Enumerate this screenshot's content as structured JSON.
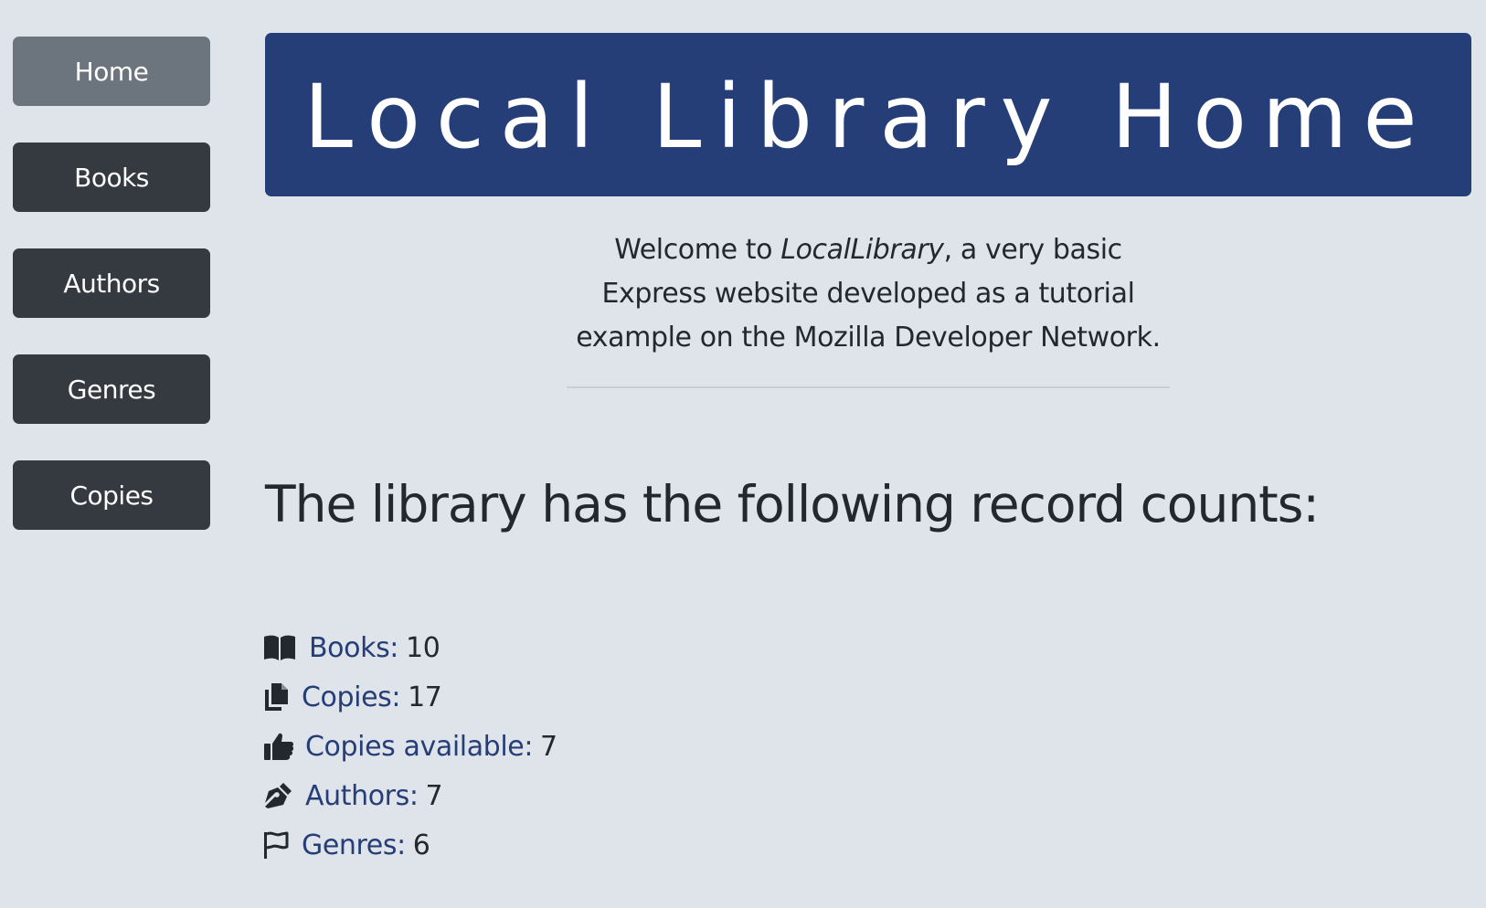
{
  "nav": {
    "items": [
      {
        "label": "Home",
        "active": true
      },
      {
        "label": "Books",
        "active": false
      },
      {
        "label": "Authors",
        "active": false
      },
      {
        "label": "Genres",
        "active": false
      },
      {
        "label": "Copies",
        "active": false
      }
    ]
  },
  "banner": {
    "title": "Local Library Home"
  },
  "intro": {
    "prefix": "Welcome to ",
    "app_name": "LocalLibrary",
    "suffix": ", a very basic Express website developed as a tutorial example on the Mozilla Developer Network."
  },
  "counts": {
    "heading": "The library has the following record counts:",
    "items": [
      {
        "icon": "book-open-icon",
        "label": "Books:",
        "value": "10"
      },
      {
        "icon": "copies-icon",
        "label": "Copies:",
        "value": "17"
      },
      {
        "icon": "thumbs-up-icon",
        "label": "Copies available:",
        "value": "7"
      },
      {
        "icon": "pen-nib-icon",
        "label": "Authors:",
        "value": "7"
      },
      {
        "icon": "flag-icon",
        "label": "Genres:",
        "value": "6"
      }
    ]
  },
  "colors": {
    "page_background": "#dfe3ea",
    "banner_background": "#253e77",
    "nav_button": "#343a40",
    "nav_button_active": "#6c757d",
    "link": "#253e77",
    "text": "#23272e"
  }
}
